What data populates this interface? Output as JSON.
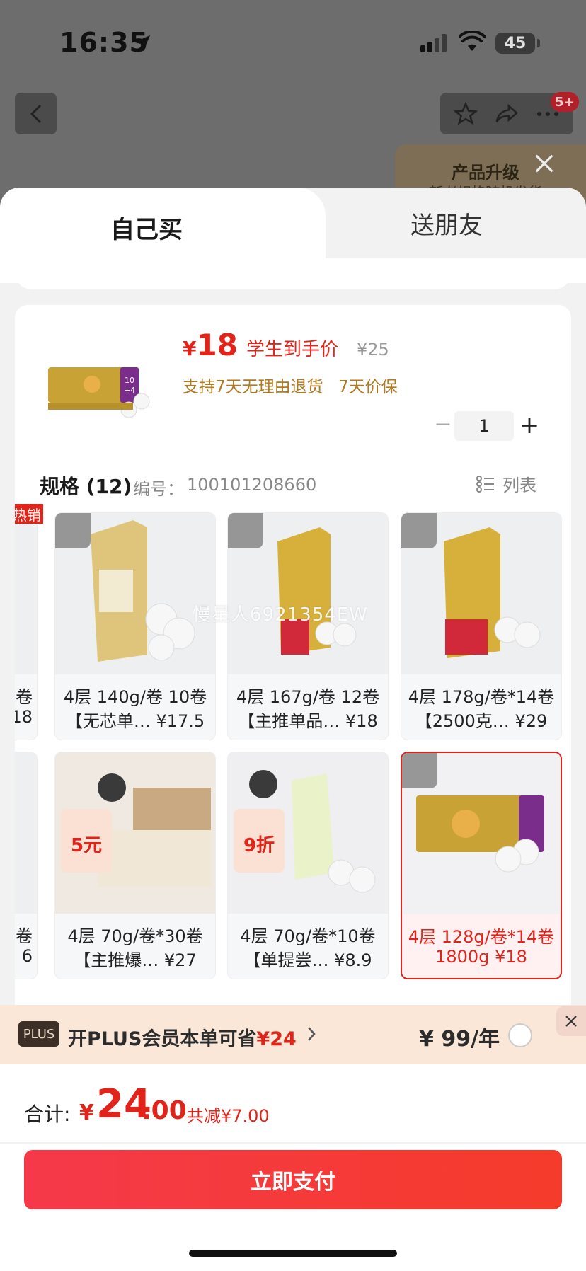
{
  "status": {
    "time": "16:35",
    "battery": "45"
  },
  "nav": {
    "badge": "5+"
  },
  "upgrade": {
    "title": "产品升级",
    "subtitle": "新老规格随机发货"
  },
  "tabs": [
    {
      "label": "自己买"
    },
    {
      "label": "送朋友"
    }
  ],
  "product": {
    "currency": "¥",
    "price": "18",
    "price_label": "学生到手价",
    "original_price": "¥25",
    "services": [
      "支持7天无理由退货",
      "7天价保"
    ],
    "quantity": "1"
  },
  "spec": {
    "title": "规格 (12)",
    "code_label": "编号：",
    "code": "100101208660",
    "view_label": "列表"
  },
  "tiles": [
    {
      "line1": "卷",
      "line2": "18",
      "hot": "热销"
    },
    {
      "line1": "4层 140g/卷 10卷",
      "line2": "【无芯单… ¥17.5"
    },
    {
      "line1": "4层 167g/卷 12卷",
      "line2": "【主推单品… ¥18"
    },
    {
      "line1": "4层 178g/卷*14卷",
      "line2": "【2500克… ¥29"
    },
    {
      "line1": "卷",
      "line2": "6"
    },
    {
      "line1": "4层 70g/卷*30卷",
      "line2": "【主推爆… ¥27"
    },
    {
      "line1": "4层 70g/卷*10卷",
      "line2": "【单提尝… ¥8.9"
    },
    {
      "line1": "4层 128g/卷*14卷",
      "line2": "1800g ¥18",
      "selected": true
    }
  ],
  "watermark": "慢星人6921354EW",
  "plus": {
    "badge": "PLUS",
    "text": "开PLUS会员本单可省",
    "save": "¥24",
    "price": "¥ 99/年"
  },
  "footer": {
    "total_label": "合计:",
    "currency": "¥",
    "total_int": "24",
    "total_dec": ".00",
    "discount": "共减¥7.00",
    "pay_label": "立即支付"
  },
  "colors": {
    "accent": "#e2231a",
    "service": "#b07a1e",
    "plus_bg": "#fbe7d8"
  }
}
